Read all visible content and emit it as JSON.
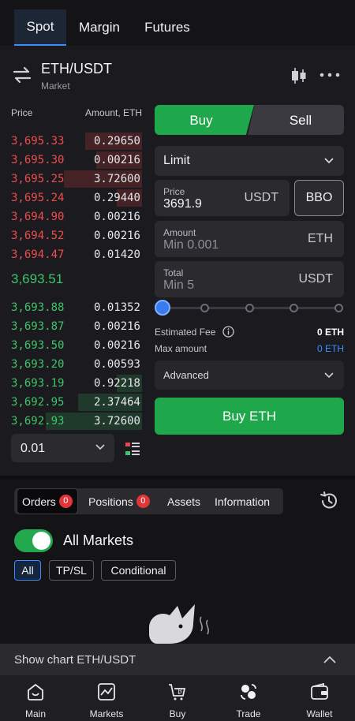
{
  "top_tabs": [
    "Spot",
    "Margin",
    "Futures"
  ],
  "header": {
    "pair": "ETH/USDT",
    "order_mode": "Market",
    "icons": [
      "swap-icon",
      "candlestick-chart-icon",
      "more-icon"
    ]
  },
  "order_book": {
    "price_header": "Price",
    "amount_header": "Amount, ETH",
    "asks": [
      {
        "price": "3,695.33",
        "amount": "0.29650",
        "depth": 0.4
      },
      {
        "price": "3,695.30",
        "amount": "0.00216",
        "depth": 0.32
      },
      {
        "price": "3,695.25",
        "amount": "3.72600",
        "depth": 0.55
      },
      {
        "price": "3,695.24",
        "amount": "0.29440",
        "depth": 0.18
      },
      {
        "price": "3,694.90",
        "amount": "0.00216",
        "depth": 0.0
      },
      {
        "price": "3,694.52",
        "amount": "0.00216",
        "depth": 0.0
      },
      {
        "price": "3,694.47",
        "amount": "0.01420",
        "depth": 0.0
      }
    ],
    "mid_price": "3,693.51",
    "bids": [
      {
        "price": "3,693.88",
        "amount": "0.01352",
        "depth": 0.0
      },
      {
        "price": "3,693.87",
        "amount": "0.00216",
        "depth": 0.0
      },
      {
        "price": "3,693.50",
        "amount": "0.00216",
        "depth": 0.0
      },
      {
        "price": "3,693.20",
        "amount": "0.00593",
        "depth": 0.0
      },
      {
        "price": "3,693.19",
        "amount": "0.92218",
        "depth": 0.18
      },
      {
        "price": "3,692.95",
        "amount": "2.37464",
        "depth": 0.45
      },
      {
        "price": "3,692.93",
        "amount": "3.72600",
        "depth": 0.68
      }
    ],
    "step": "0.01"
  },
  "form": {
    "buy_label": "Buy",
    "sell_label": "Sell",
    "order_type": "Limit",
    "price_label": "Price",
    "price_value": "3691.9",
    "price_unit": "USDT",
    "bbo_label": "BBO",
    "amount_label": "Amount",
    "amount_placeholder": "Min 0.001",
    "amount_unit": "ETH",
    "total_label": "Total",
    "total_placeholder": "Min 5",
    "total_unit": "USDT",
    "slider_level": 0,
    "fee_label": "Estimated Fee",
    "fee_value": "0 ETH",
    "max_label": "Max amount",
    "max_value": "0 ETH",
    "advanced_label": "Advanced",
    "submit_label": "Buy ETH"
  },
  "orders": {
    "tabs": [
      {
        "label": "Orders",
        "badge": "0"
      },
      {
        "label": "Positions",
        "badge": "0"
      },
      {
        "label": "Assets"
      },
      {
        "label": "Information"
      }
    ],
    "all_markets_label": "All Markets",
    "all_markets_on": true,
    "filters": [
      "All",
      "TP/SL",
      "Conditional"
    ]
  },
  "show_chart": "Show chart ETH/USDT",
  "bottom_nav": [
    "Main",
    "Markets",
    "Buy",
    "Trade",
    "Wallet"
  ],
  "colors": {
    "buy": "#1fa74b",
    "ask": "#ef4d4d",
    "bid": "#3ec46b",
    "accent": "#3a8cff",
    "badge": "#e0363a"
  }
}
